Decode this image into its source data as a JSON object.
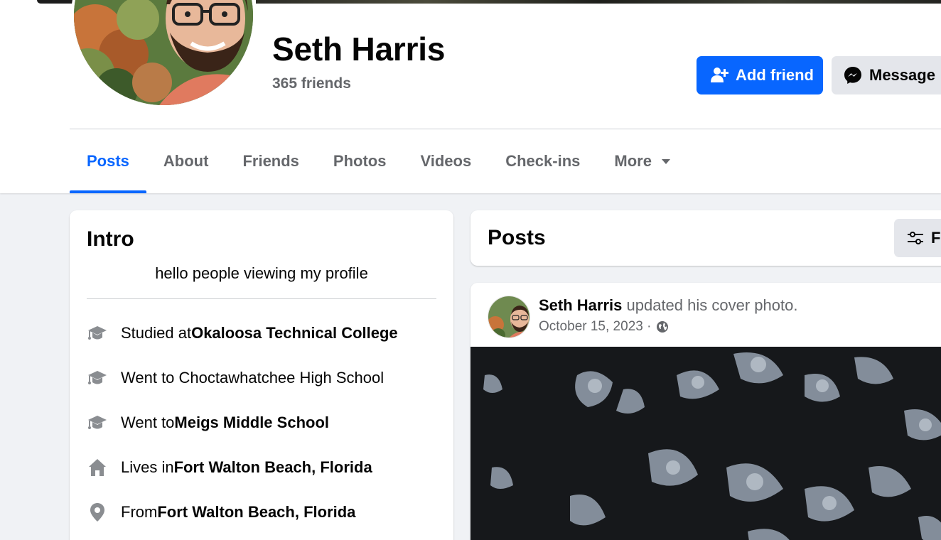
{
  "profile": {
    "name": "Seth Harris",
    "friends_count": "365 friends"
  },
  "actions": {
    "add_friend": "Add friend",
    "message": "Message"
  },
  "tabs": [
    {
      "label": "Posts",
      "active": true
    },
    {
      "label": "About"
    },
    {
      "label": "Friends"
    },
    {
      "label": "Photos"
    },
    {
      "label": "Videos"
    },
    {
      "label": "Check-ins"
    },
    {
      "label": "More"
    }
  ],
  "intro": {
    "title": "Intro",
    "bio": "hello people viewing my profile",
    "items": [
      {
        "icon": "graduation-cap-icon",
        "prefix": "Studied at ",
        "value": "Okaloosa Technical College"
      },
      {
        "icon": "graduation-cap-icon",
        "prefix": "Went to Choctawhatchee High School",
        "value": ""
      },
      {
        "icon": "graduation-cap-icon",
        "prefix": "Went to ",
        "value": "Meigs Middle School"
      },
      {
        "icon": "home-icon",
        "prefix": "Lives in ",
        "value": "Fort Walton Beach, Florida"
      },
      {
        "icon": "location-pin-icon",
        "prefix": "From ",
        "value": "Fort Walton Beach, Florida"
      }
    ]
  },
  "posts": {
    "title": "Posts",
    "filter_label": "Fi"
  },
  "post": {
    "author": "Seth Harris",
    "action": " updated his cover photo.",
    "date": "October 15, 2023 ·"
  },
  "colors": {
    "accent": "#0866ff",
    "secondary_text": "#65676b",
    "background": "#f0f2f5"
  }
}
